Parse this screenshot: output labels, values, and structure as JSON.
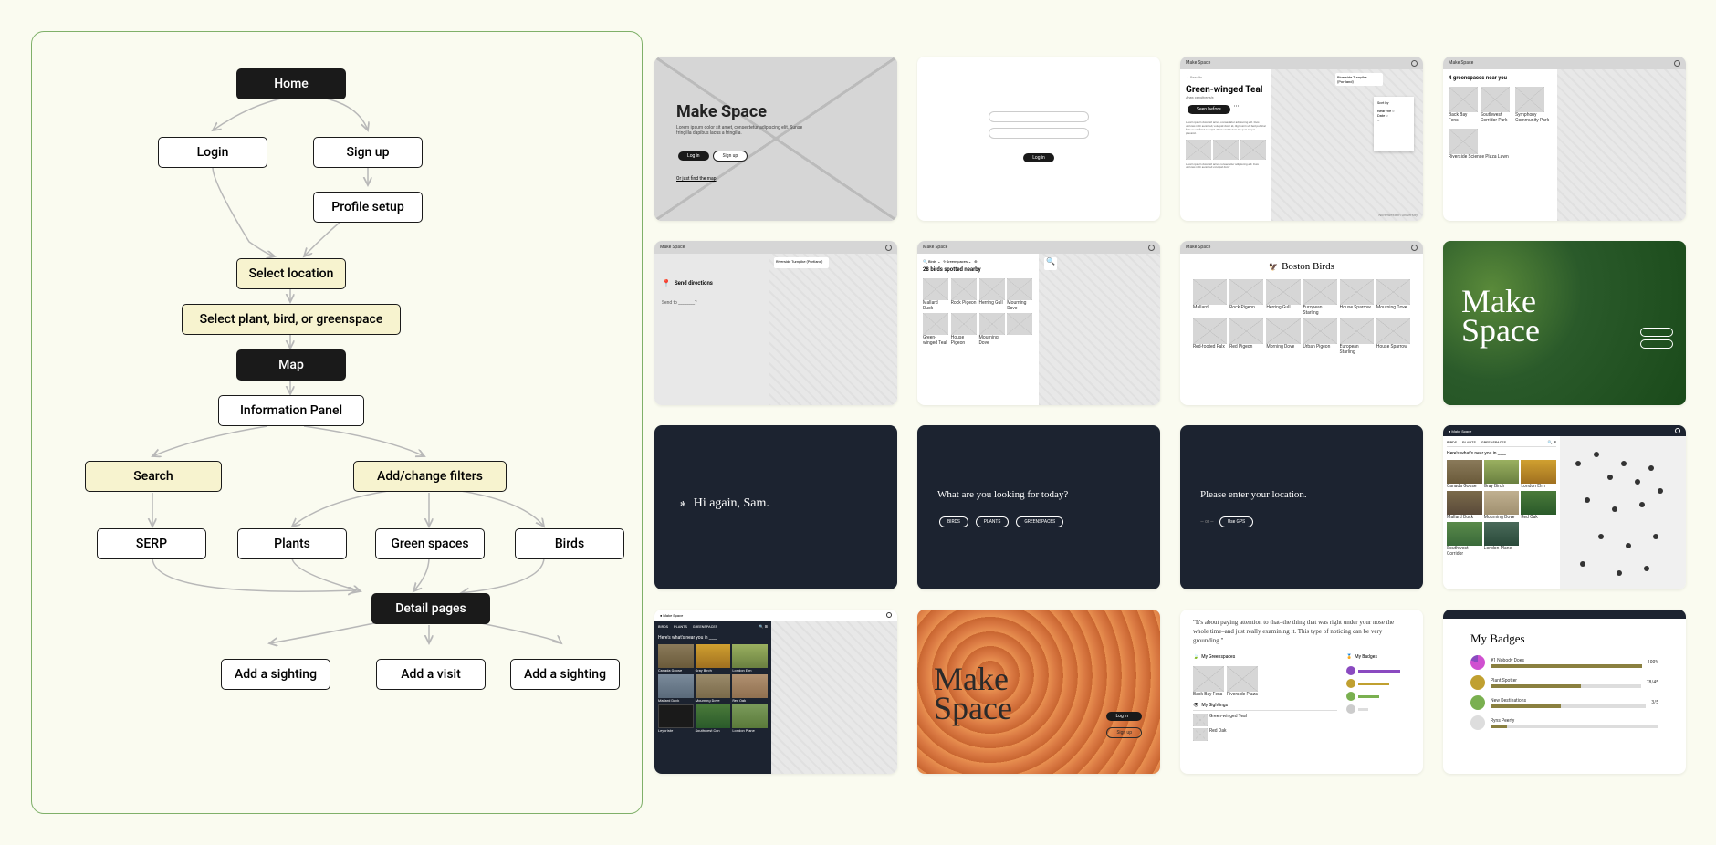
{
  "flowchart": {
    "home": "Home",
    "login": "Login",
    "signup": "Sign up",
    "profile_setup": "Profile setup",
    "select_location": "Select location",
    "select_pbg": "Select plant, bird, or greenspace",
    "map": "Map",
    "info_panel": "Information Panel",
    "search": "Search",
    "filters": "Add/change filters",
    "serp": "SERP",
    "plants": "Plants",
    "green_spaces": "Green spaces",
    "birds": "Birds",
    "detail_pages": "Detail pages",
    "add_sighting_1": "Add a sighting",
    "add_visit": "Add a visit",
    "add_sighting_2": "Add a sighting"
  },
  "thumbs": {
    "t1": {
      "title": "Make Space",
      "lorem": "Lorem ipsum dolor sit amet, consectetur adipiscing elit. Sunse fringilla dapibus lacus a fringilla.",
      "login": "Log in",
      "signup": "Sign up",
      "link": "Or just find the map"
    },
    "t2": {
      "btn": "Log in"
    },
    "t3": {
      "app": "Make Space",
      "title": "Green-winged Teal",
      "subtitle": "Anas carolinensis",
      "seen": "Seen before",
      "sort": "Sort by",
      "brand": "Northwestern University"
    },
    "t4": {
      "app": "Make Space",
      "title": "4 greenspaces near you",
      "items": [
        "Back Bay Fens",
        "Southwest Corridor Park",
        "Symphony Community Park",
        "Riverside Science Plaza Lawn"
      ]
    },
    "t5": {
      "app": "Make Space",
      "send": "Send directions",
      "to": "Send to ________?"
    },
    "t6": {
      "app": "Make Space",
      "title": "28 birds spotted nearby",
      "items": [
        "Mallard Duck",
        "Rock Pigeon",
        "Herring Gull",
        "Mourning Dove",
        "Green-winged Teal",
        "House Pigeon",
        "Mourning Dove"
      ]
    },
    "t7": {
      "app": "Make Space",
      "title": "Boston Birds",
      "items": [
        "Mallard",
        "Rock Pigeon",
        "Herring Gull",
        "European Starling",
        "House Sparrow",
        "Mourning Dove",
        "Red-footed Falx",
        "Red Pigeon",
        "Morning Dove",
        "Urban Pigeon",
        "European Starling",
        "House Sparrow"
      ]
    },
    "t8": {
      "title": "Make Space"
    },
    "t9": {
      "greeting": "Hi again, Sam."
    },
    "t10": {
      "q": "What are you looking for today?",
      "opts": [
        "BIRDS",
        "PLANTS",
        "GREENSPACES"
      ]
    },
    "t11": {
      "q": "Please enter your location.",
      "btn": "Use GPS"
    },
    "t12": {
      "app": "Make Space",
      "tabs": [
        "BIRDS",
        "PLANTS",
        "GREENSPACES"
      ],
      "title": "Here's what's near you in ____",
      "items": [
        "Canada Goose",
        "Gray Birch",
        "London Elm",
        "Mallard Duck",
        "Mourning Dove",
        "Red Oak",
        "Southwest Corridor",
        "London Plane"
      ]
    },
    "t13": {
      "app": "Make Space",
      "tabs": [
        "BIRDS",
        "PLANTS",
        "GREENSPACES"
      ],
      "title": "Here's what's near you in ____",
      "items": [
        "Canada Goose",
        "Gray Birch",
        "London Elm",
        "Mallard Duck",
        "Mourning Dove",
        "Red Oak",
        "Leyoriste",
        "Southwest Con",
        "London Plane"
      ]
    },
    "t14": {
      "title": "Make Space",
      "login": "Log in",
      "signup": "Sign up"
    },
    "t15": {
      "quote": "\"It's about paying attention to that–the thing that was right under your nose the whole time–and just really examining it. This type of noticing can be very grounding.\"",
      "h1": "My Greenspaces",
      "h2": "My Badges",
      "h3": "My Sightings",
      "g1": "Back Bay Fens",
      "g2": "Riverside Plaza"
    },
    "t16": {
      "title": "My Badges",
      "badges": [
        {
          "name": "#1 Nobody Does",
          "pct": "100%"
        },
        {
          "name": "Plant Spotter",
          "pct": "78/45"
        },
        {
          "name": "New Destinations",
          "pct": "3/5"
        },
        {
          "name": "Ryns Peerty",
          "pct": ""
        }
      ]
    }
  }
}
